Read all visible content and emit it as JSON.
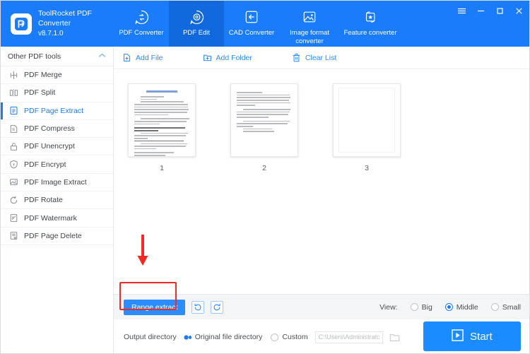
{
  "window": {
    "app_name": "ToolRocket PDF Converter",
    "version": "v8.7.1.0",
    "controls": [
      {
        "name": "menu-icon",
        "glyph": "≡"
      },
      {
        "name": "minimize-icon",
        "glyph": "–"
      },
      {
        "name": "maximize-icon",
        "glyph": "□"
      },
      {
        "name": "close-icon",
        "glyph": "✕"
      }
    ]
  },
  "colors": {
    "brand_blue": "#1a7cfa",
    "active_tab": "#1268dd",
    "accent": "#2b8cff",
    "highlight_red": "#f02b24",
    "text": "#3e444c"
  },
  "tabs": [
    {
      "label": "PDF Converter",
      "icon": "convert-icon",
      "active": false
    },
    {
      "label": "PDF Edit",
      "icon": "edit-gear-icon",
      "active": true
    },
    {
      "label": "CAD Converter",
      "icon": "cad-icon",
      "active": false
    },
    {
      "label": "Image format converter",
      "icon": "image-icon",
      "active": false
    },
    {
      "label": "Feature converter",
      "icon": "feature-star-icon",
      "active": false
    }
  ],
  "sidebar": {
    "header": "Other PDF tools",
    "items": [
      {
        "label": "PDF Merge",
        "icon": "merge-icon",
        "active": false
      },
      {
        "label": "PDF Split",
        "icon": "split-icon",
        "active": false
      },
      {
        "label": "PDF Page Extract",
        "icon": "page-extract-icon",
        "active": true
      },
      {
        "label": "PDF Compress",
        "icon": "compress-icon",
        "active": false
      },
      {
        "label": "PDF Unencrypt",
        "icon": "unlock-icon",
        "active": false
      },
      {
        "label": "PDF Encrypt",
        "icon": "shield-icon",
        "active": false
      },
      {
        "label": "PDF Image Extract",
        "icon": "image-extract-icon",
        "active": false
      },
      {
        "label": "PDF Rotate",
        "icon": "rotate-icon",
        "active": false
      },
      {
        "label": "PDF Watermark",
        "icon": "watermark-icon",
        "active": false
      },
      {
        "label": "PDF Page Delete",
        "icon": "page-delete-icon",
        "active": false
      }
    ]
  },
  "toolbar": {
    "add_file": "Add File",
    "add_folder": "Add Folder",
    "clear_list": "Clear List"
  },
  "pages": [
    {
      "number": "1",
      "kind": "full-text"
    },
    {
      "number": "2",
      "kind": "partial-text"
    },
    {
      "number": "3",
      "kind": "blank"
    }
  ],
  "controls": {
    "range_extract": "Range extract",
    "rotate_left_icon": "rotate-left-icon",
    "rotate_right_icon": "rotate-right-icon",
    "view_label": "View:",
    "view_options": [
      {
        "label": "Big",
        "selected": false
      },
      {
        "label": "Middle",
        "selected": true
      },
      {
        "label": "Small",
        "selected": false
      }
    ]
  },
  "output": {
    "label": "Output directory",
    "options": [
      {
        "label": "Original file directory",
        "selected": true
      },
      {
        "label": "Custom",
        "selected": false
      }
    ],
    "path_value": "C:\\Users\\Administratc",
    "browse_icon": "folder-icon"
  },
  "start": {
    "label": "Start",
    "icon": "play-icon"
  }
}
